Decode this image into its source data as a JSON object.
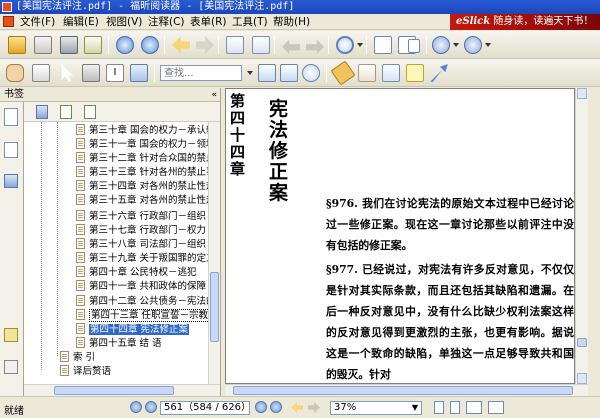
{
  "window": {
    "title": "[美国宪法评注.pdf] - 福昕阅读器 - [美国宪法评注.pdf]"
  },
  "menu": {
    "items": [
      "文件(F)",
      "编辑(E)",
      "视图(V)",
      "注释(C)",
      "表单(R)",
      "工具(T)",
      "帮助(H)"
    ],
    "banner_brand": "eSlick",
    "banner_text": "随身读，读遍天下书！"
  },
  "toolbar": {
    "search_placeholder": "查找..."
  },
  "bookmarks": {
    "header": "书签",
    "items": [
      "第三十章 国会的权力－承认新州加入联邦的权力",
      "第三十一章 国会的权力－领地和其他财产",
      "第三十二章 针对合众国的禁止事项",
      "第三十三章 针对各州的禁止事项",
      "第三十四章 对各州的禁止性规定",
      "第三十五章 对各州的禁止性规定",
      "第三十六章 行政部门－组织",
      "第三十七章 行政部门－权力",
      "第三十八章 司法部门－组织",
      "第三十九章 关于叛国罪的定义",
      "第四十章 公民特权－逃犯",
      "第四十一章 共和政体的保障",
      "第四十二章 公共债务－宪法的至上性",
      "第四十三章 任职宣誓－宗教标准、宪法的批准",
      "第四十四章 宪法修正案",
      "第四十五章 结 语",
      "索 引",
      "译后赘语"
    ],
    "tooltip": "第四十三章 任职宣誓－宗教标准、宪法的批准"
  },
  "document": {
    "chapter_number": "第四十四章",
    "chapter_title": "宪法修正案",
    "para1": "§976. 我们在讨论宪法的原始文本过程中已经讨论过一些修正案。现在这一章讨论那些以前评注中没有包括的修正案。",
    "para2": "§977. 已经说过，对宪法有许多反对意见，不仅仅是针对其实际条款，而且还包括其缺陷和遗漏。在后一种反对意见中，没有什么比缺少权利法案这样的反对意见得到更激烈的主张，也更有影响。据说这是一个致命的缺陷，单独这一点足够导致共和国的毁灭。针对"
  },
  "status": {
    "text": "就绪",
    "page": "561（584 / 626）",
    "zoom": "37%"
  }
}
